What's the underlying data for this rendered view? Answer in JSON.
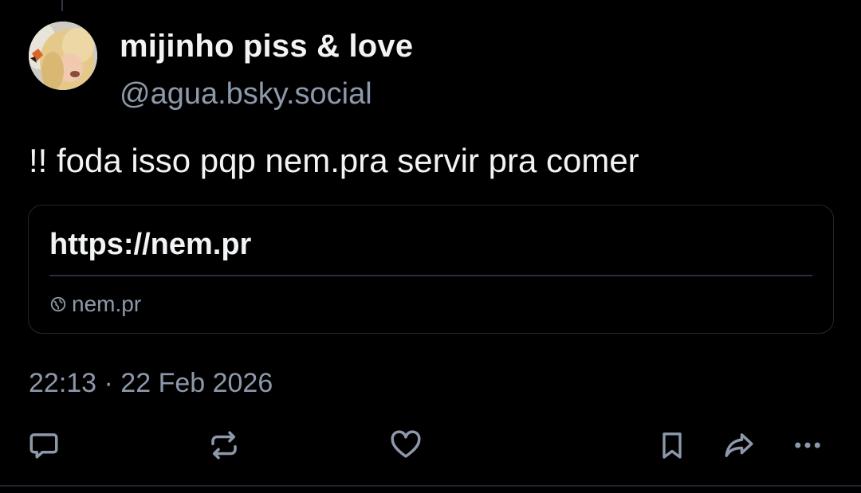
{
  "post": {
    "author": {
      "display_name": "mijinho piss & love",
      "handle": "@agua.bsky.social"
    },
    "text": "!! foda isso pqp nem.pra servir pra comer",
    "link_card": {
      "title": "https://nem.pr",
      "domain": "nem.pr",
      "domain_icon": "globe-icon"
    },
    "timestamp": "22:13 · 22 Feb 2026",
    "actions": [
      {
        "name": "reply",
        "icon": "speech-bubble-icon"
      },
      {
        "name": "repost",
        "icon": "repost-arrows-icon"
      },
      {
        "name": "like",
        "icon": "heart-icon"
      },
      {
        "name": "bookmark",
        "icon": "bookmark-icon"
      },
      {
        "name": "share",
        "icon": "share-arrow-icon"
      },
      {
        "name": "more",
        "icon": "ellipsis-icon"
      }
    ]
  },
  "theme": {
    "background": "#000000",
    "text_primary": "#f1f3f5",
    "text_secondary": "#8d99ab",
    "icon_color": "#8d99ab",
    "border": "#1f2731"
  }
}
